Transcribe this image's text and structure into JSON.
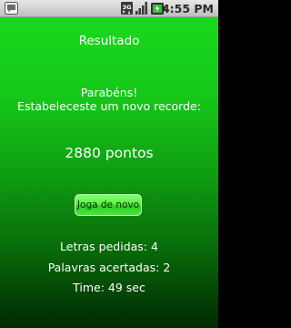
{
  "status_bar": {
    "time": "4:55 PM",
    "network_label": "3G",
    "icons": [
      "notification-icon",
      "3g-network-icon",
      "signal-icon",
      "battery-charging-icon"
    ]
  },
  "result": {
    "title": "Resultado",
    "congrats": "Parabéns!",
    "record_message": "Estabeleceste um novo recorde:",
    "score": "2880 pontos",
    "play_again_label": "Joga de novo"
  },
  "stats": {
    "letters_requested": "Letras pedidas: 4",
    "words_correct": "Palavras acertadas: 2",
    "time": "Time: 49 sec"
  },
  "colors": {
    "background_top": "#19d81d",
    "background_bottom": "#022903",
    "button": "#5cf24a",
    "text": "#ffffff"
  }
}
